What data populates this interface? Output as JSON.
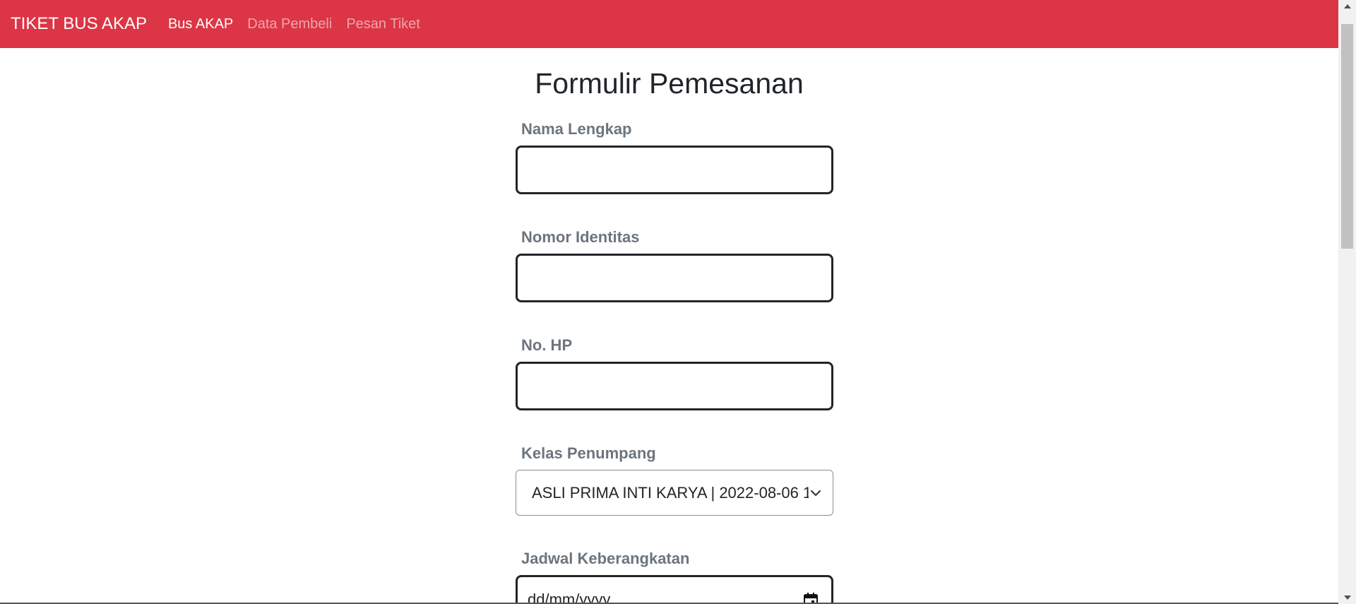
{
  "navbar": {
    "brand": "TIKET BUS AKAP",
    "links": [
      {
        "label": "Bus AKAP",
        "active": true
      },
      {
        "label": "Data Pembeli",
        "active": false
      },
      {
        "label": "Pesan Tiket",
        "active": false
      }
    ],
    "background_color": "#dc3545"
  },
  "form": {
    "title": "Formulir Pemesanan",
    "fields": {
      "nama": {
        "label": "Nama Lengkap",
        "value": ""
      },
      "identitas": {
        "label": "Nomor Identitas",
        "value": ""
      },
      "hp": {
        "label": "No. HP",
        "value": ""
      },
      "kelas": {
        "label": "Kelas Penumpang",
        "selected": "ASLI PRIMA INTI KARYA | 2022-08-06 1"
      },
      "jadwal": {
        "label": "Jadwal Keberangkatan",
        "value": "dd/mm/yyyy"
      }
    }
  },
  "icons": {
    "select_chevron": "chevron-down-icon",
    "calendar": "calendar-icon",
    "scroll_up": "scroll-up-arrow-icon",
    "scroll_down": "scroll-down-arrow-icon"
  }
}
